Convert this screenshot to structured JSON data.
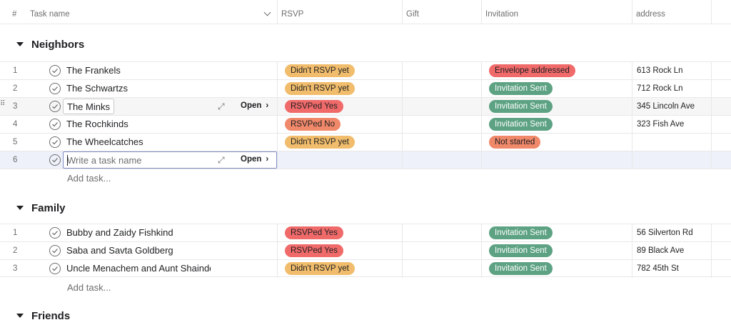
{
  "header": {
    "num": "#",
    "task_name": "Task name",
    "rsvp": "RSVP",
    "gift": "Gift",
    "invitation": "Invitation",
    "address": "address"
  },
  "colors": {
    "didnt_rsvp": "#f1bd6c",
    "rsvped_yes": "#f06a6a",
    "rsvped_no": "#f0886a",
    "envelope_addressed": "#f06a6a",
    "invitation_sent": "#5da283",
    "not_started": "#f0886a"
  },
  "sections": [
    {
      "title": "Neighbors",
      "add_task": "Add task...",
      "rows": [
        {
          "num": "1",
          "name": "The Frankels",
          "rsvp": "Didn't RSVP yet",
          "invitation": "Envelope addressed",
          "address": "613 Rock Ln"
        },
        {
          "num": "2",
          "name": "The Schwartzs",
          "rsvp": "Didn't RSVP yet",
          "invitation": "Invitation Sent",
          "address": "712 Rock Ln"
        },
        {
          "num": "3",
          "name": "The Minks",
          "rsvp": "RSVPed Yes",
          "invitation": "Invitation Sent",
          "address": "345 Lincoln Ave",
          "open_label": "Open"
        },
        {
          "num": "4",
          "name": "The Rochkinds",
          "rsvp": "RSVPed No",
          "invitation": "Invitation Sent",
          "address": "323 Fish Ave"
        },
        {
          "num": "5",
          "name": "The Wheelcatches",
          "rsvp": "Didn't RSVP yet",
          "invitation": "Not started",
          "address": ""
        },
        {
          "num": "6",
          "placeholder": "Write a task name",
          "open_label": "Open"
        }
      ]
    },
    {
      "title": "Family",
      "add_task": "Add task...",
      "rows": [
        {
          "num": "1",
          "name": "Bubby and Zaidy Fishkind",
          "rsvp": "RSVPed Yes",
          "invitation": "Invitation Sent",
          "address": "56 Silverton Rd"
        },
        {
          "num": "2",
          "name": "Saba and Savta Goldberg",
          "rsvp": "RSVPed Yes",
          "invitation": "Invitation Sent",
          "address": "89 Black Ave"
        },
        {
          "num": "3",
          "name": "Uncle Menachem and Aunt Shainde",
          "rsvp": "Didn't RSVP yet",
          "invitation": "Invitation Sent",
          "address": "782 45th St"
        }
      ]
    },
    {
      "title": "Friends"
    }
  ]
}
